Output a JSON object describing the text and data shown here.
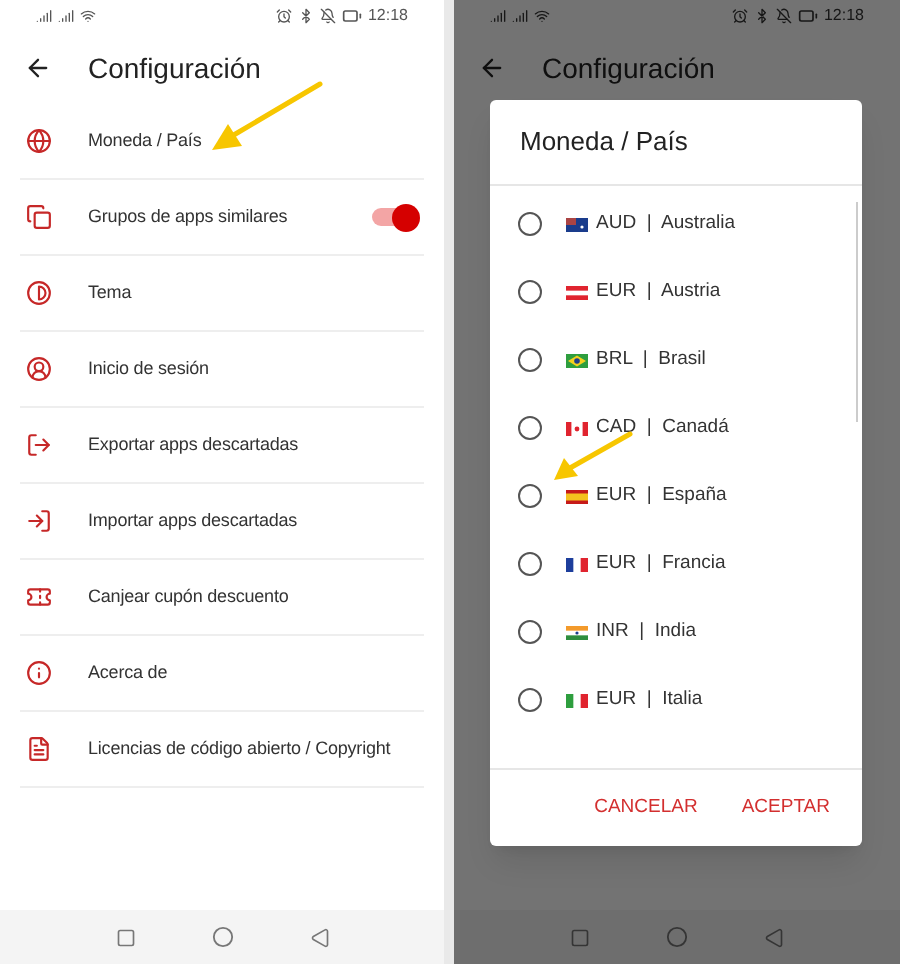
{
  "settings_screen": {
    "status_bar": {
      "time": "12:18"
    },
    "header": {
      "title": "Configuración"
    },
    "settings": [
      {
        "label": "Moneda / País",
        "kind": "link"
      },
      {
        "label": "Grupos de apps similares",
        "kind": "toggle",
        "on": true
      },
      {
        "label": "Tema",
        "kind": "link"
      },
      {
        "label": "Inicio de sesión",
        "kind": "link"
      },
      {
        "label": "Exportar apps descartadas",
        "kind": "link"
      },
      {
        "label": "Importar apps descartadas",
        "kind": "link"
      },
      {
        "label": "Canjear cupón descuento",
        "kind": "link"
      },
      {
        "label": "Acerca de",
        "kind": "link"
      },
      {
        "label": "Licencias de código abierto / Copyright",
        "kind": "link"
      }
    ]
  },
  "dialog_screen": {
    "status_bar": {
      "time": "12:18"
    },
    "header": {
      "title": "Configuración"
    },
    "dialog": {
      "title": "Moneda / País",
      "options": [
        {
          "label": "AUD  |  Australia",
          "selected": false
        },
        {
          "label": "EUR  |  Austria",
          "selected": false
        },
        {
          "label": "BRL  |  Brasil",
          "selected": false
        },
        {
          "label": "CAD  |  Canadá",
          "selected": false
        },
        {
          "label": "EUR  |  España",
          "selected": false
        },
        {
          "label": "EUR  |  Francia",
          "selected": false
        },
        {
          "label": "INR  |  India",
          "selected": false
        },
        {
          "label": "EUR  |  Italia",
          "selected": false
        }
      ],
      "buttons": [
        "CANCELAR",
        "ACEPTAR"
      ]
    }
  }
}
